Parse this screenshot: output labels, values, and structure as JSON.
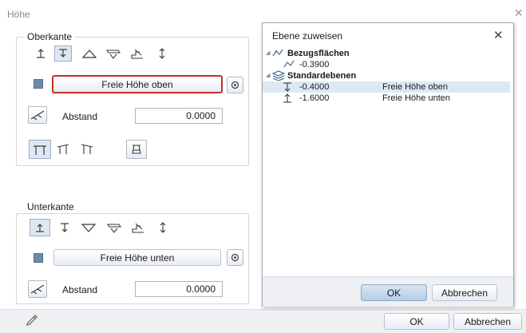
{
  "window": {
    "title": "Höhe",
    "close_glyph": "✕"
  },
  "oberkante": {
    "group_label": "Oberkante",
    "button_label": "Freie Höhe oben",
    "abstand_label": "Abstand",
    "abstand_value": "0.0000"
  },
  "unterkante": {
    "group_label": "Unterkante",
    "button_label": "Freie Höhe unten",
    "abstand_label": "Abstand",
    "abstand_value": "0.0000"
  },
  "popup": {
    "title": "Ebene zuweisen",
    "close_glyph": "✕",
    "tree": {
      "bezugsflaechen": {
        "label": "Bezugsflächen",
        "items": [
          {
            "value": "-0.3900"
          }
        ]
      },
      "standardebenen": {
        "label": "Standardebenen",
        "items": [
          {
            "value": "-0.4000",
            "name": "Freie Höhe oben",
            "selected": true
          },
          {
            "value": "-1.6000",
            "name": "Freie Höhe unten",
            "selected": false
          }
        ]
      }
    },
    "ok_label": "OK",
    "cancel_label": "Abbrechen"
  },
  "footer": {
    "ok_label": "OK",
    "cancel_label": "Abbrechen"
  },
  "icons": [
    "eyedropper-icon",
    "info-icon",
    "settings-icon",
    "align-top-icon",
    "align-bottom-icon",
    "triangle-up-icon",
    "triangle-down-icon",
    "plane-icon",
    "stairs-icon",
    "arrows-updown-icon",
    "incline-icon",
    "frame-icon",
    "cone-icon",
    "reference-surface-icon",
    "layers-icon",
    "level-down-icon",
    "level-up-icon"
  ]
}
